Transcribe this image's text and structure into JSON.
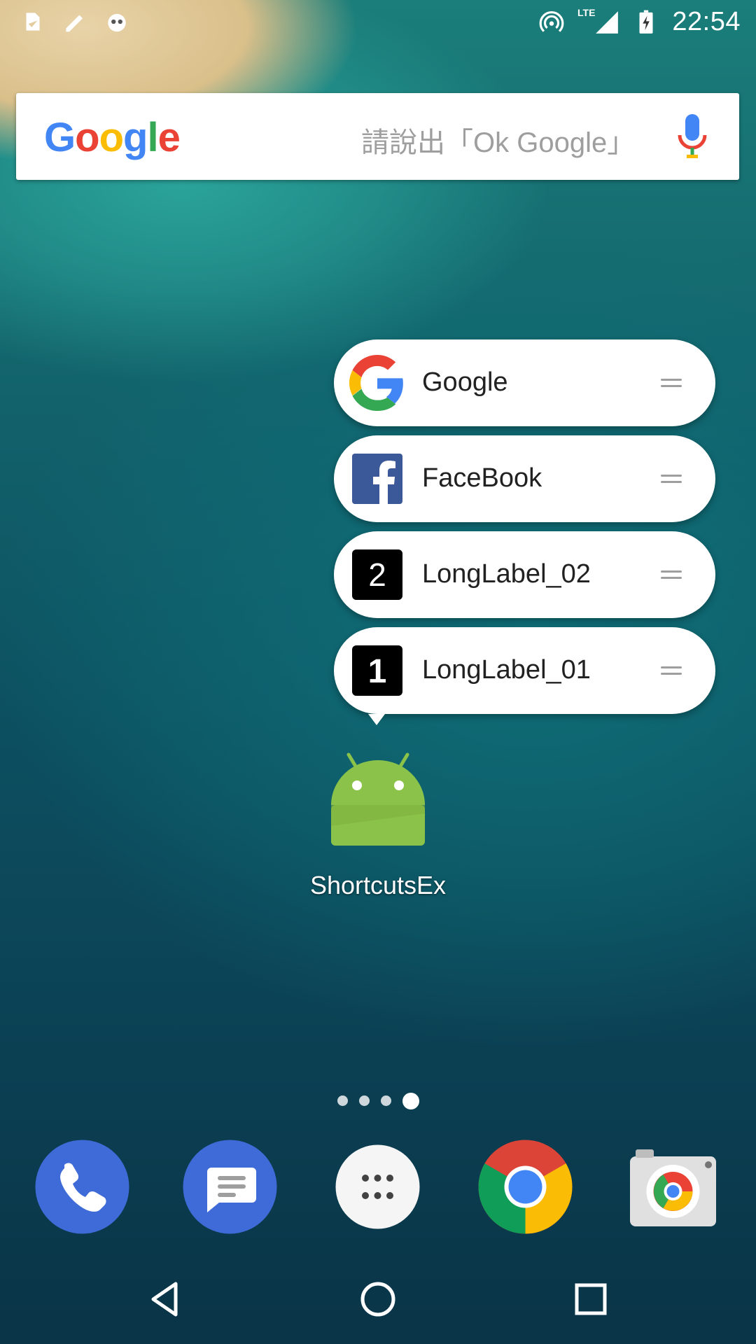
{
  "status_bar": {
    "time": "22:54",
    "network": "LTE",
    "left_icons": [
      "notification-icon-1",
      "notification-icon-2",
      "notification-icon-3"
    ],
    "right_icons": [
      "hotspot-icon",
      "signal-icon",
      "battery-charging-icon"
    ]
  },
  "search": {
    "logo": "Google",
    "hint": "請說出「Ok Google」",
    "mic_icon": "mic-icon"
  },
  "shortcuts": [
    {
      "label": "Google",
      "icon": "google-g-icon"
    },
    {
      "label": "FaceBook",
      "icon": "facebook-icon"
    },
    {
      "label": "LongLabel_02",
      "icon": "number-2-icon"
    },
    {
      "label": "LongLabel_01",
      "icon": "number-1-icon"
    }
  ],
  "app": {
    "label": "ShortcutsEx",
    "icon": "android-icon"
  },
  "page_indicator": {
    "total": 4,
    "active": 4
  },
  "dock": [
    {
      "name": "phone",
      "icon": "phone-icon"
    },
    {
      "name": "messages",
      "icon": "messages-icon"
    },
    {
      "name": "app-drawer",
      "icon": "app-drawer-icon"
    },
    {
      "name": "chrome",
      "icon": "chrome-icon"
    },
    {
      "name": "camera",
      "icon": "camera-icon"
    }
  ],
  "nav": [
    "back-icon",
    "home-icon",
    "recents-icon"
  ],
  "colors": {
    "google_blue": "#4285F4",
    "google_red": "#EA4335",
    "google_yellow": "#FBBC05",
    "google_green": "#34A853",
    "facebook_blue": "#3B5998",
    "android_green": "#8BC34A"
  }
}
